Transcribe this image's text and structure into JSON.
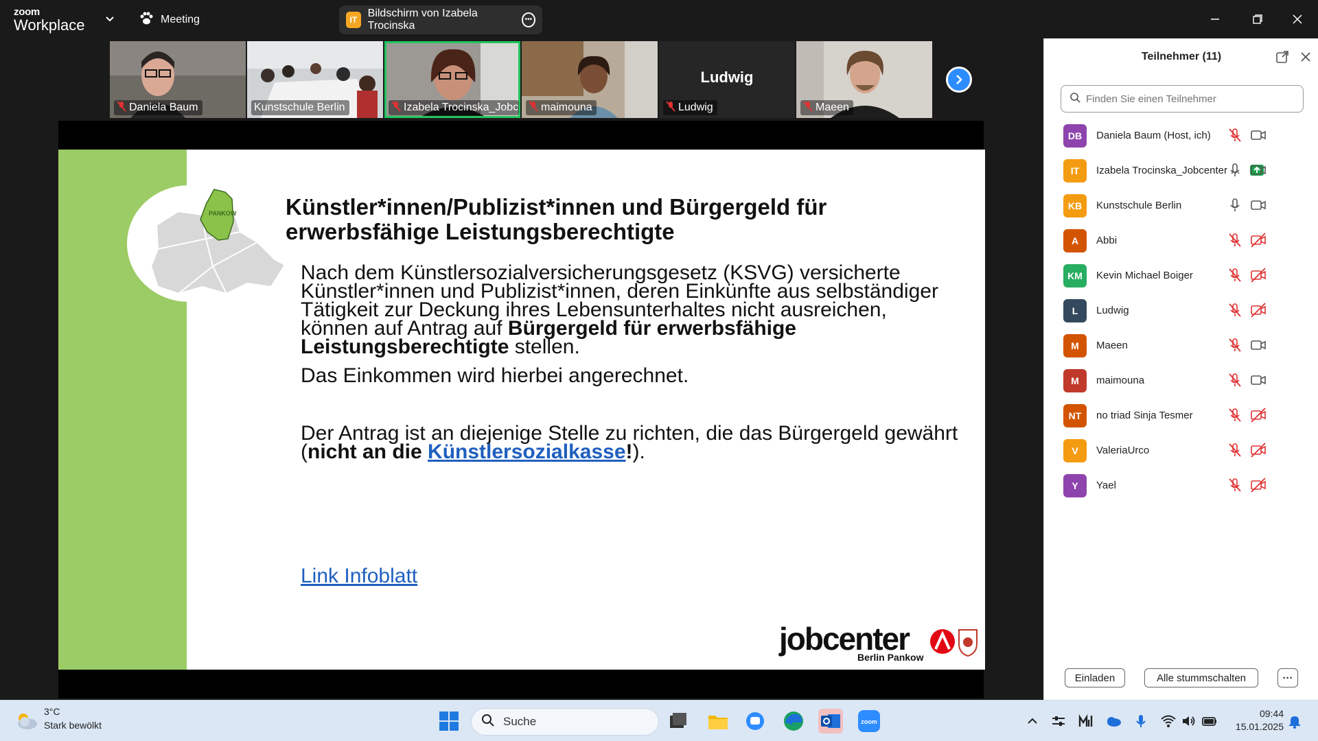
{
  "topbar": {
    "logo_small": "zoom",
    "logo_big": "Workplace",
    "meeting_label": "Meeting",
    "share_badge": "IT",
    "share_label": "Bildschirm von Izabela Trocinska"
  },
  "video_tiles": [
    {
      "name": "Daniela Baum",
      "muted": true
    },
    {
      "name": "Kunstschule Berlin",
      "muted": false
    },
    {
      "name": "Izabela Trocinska_Jobcent...",
      "muted": true,
      "active": true
    },
    {
      "name": "maimouna",
      "muted": true
    },
    {
      "name": "Ludwig",
      "muted": true,
      "big_label": "Ludwig"
    },
    {
      "name": "Maeen",
      "muted": true
    }
  ],
  "slide": {
    "map_label": "PANKOW",
    "title": "Künstler*innen/Publizist*innen und Bürgergeld für erwerbsfähige Leistungsberechtigte",
    "p1_a": "Nach dem Künstlersozialversicherungsgesetz (KSVG) versicherte Künstler*innen und Publizist*innen, deren Einkünfte aus selbständiger Tätigkeit zur Deckung ihres Lebensunterhaltes nicht ausreichen, können auf Antrag auf ",
    "p1_b": "Bürgergeld für erwerbsfähige Leistungsberechtigte",
    "p1_c": " stellen.",
    "p2": "Das Einkommen wird hierbei angerechnet.",
    "p3_a": "Der Antrag ist an diejenige Stelle zu richten, die das Bürgergeld gewährt (",
    "p3_b": "nicht an die ",
    "p3_link": "Künstlersozialkasse",
    "p3_c": "!",
    "p3_d": ").",
    "link_infoblatt": "Link Infoblatt",
    "logo_word": "jobcenter",
    "logo_sub": "Berlin Pankow"
  },
  "panel": {
    "title": "Teilnehmer (11)",
    "search_placeholder": "Finden Sie einen Teilnehmer",
    "participants": [
      {
        "initials": "DB",
        "name": "Daniela Baum (Host, ich)",
        "color": "#8e44ad",
        "mic": "muted",
        "cam": "on"
      },
      {
        "initials": "IT",
        "name": "Izabela Trocinska_Jobcenter B...",
        "color": "#f39c12",
        "mic": "on",
        "cam": "on",
        "sharing": true
      },
      {
        "initials": "KB",
        "name": "Kunstschule Berlin",
        "color": "#f39c12",
        "mic": "on",
        "cam": "on"
      },
      {
        "initials": "A",
        "name": "Abbi",
        "color": "#d35400",
        "mic": "muted",
        "cam": "off"
      },
      {
        "initials": "KM",
        "name": "Kevin Michael Boiger",
        "color": "#27ae60",
        "mic": "muted",
        "cam": "off"
      },
      {
        "initials": "L",
        "name": "Ludwig",
        "color": "#34495e",
        "mic": "muted",
        "cam": "off"
      },
      {
        "initials": "M",
        "name": "Maeen",
        "color": "#d35400",
        "mic": "muted",
        "cam": "on"
      },
      {
        "initials": "M",
        "name": "maimouna",
        "color": "#c0392b",
        "mic": "muted",
        "cam": "on"
      },
      {
        "initials": "NT",
        "name": "no triad Sinja Tesmer",
        "color": "#d35400",
        "mic": "muted",
        "cam": "off"
      },
      {
        "initials": "V",
        "name": "ValeriaUrco",
        "color": "#f39c12",
        "mic": "muted",
        "cam": "off"
      },
      {
        "initials": "Y",
        "name": "Yael",
        "color": "#8e44ad",
        "mic": "muted",
        "cam": "off"
      }
    ],
    "invite_label": "Einladen",
    "mute_all_label": "Alle stummschalten",
    "more_label": "···"
  },
  "taskbar": {
    "weather_temp": "3°C",
    "weather_desc": "Stark bewölkt",
    "search_label": "Suche",
    "time": "09:44",
    "date": "15.01.2025"
  },
  "colors": {
    "accent": "#2d8cff",
    "active_speaker": "#22c55e",
    "muted_red": "#e03131",
    "slide_green": "#9ccc65"
  }
}
